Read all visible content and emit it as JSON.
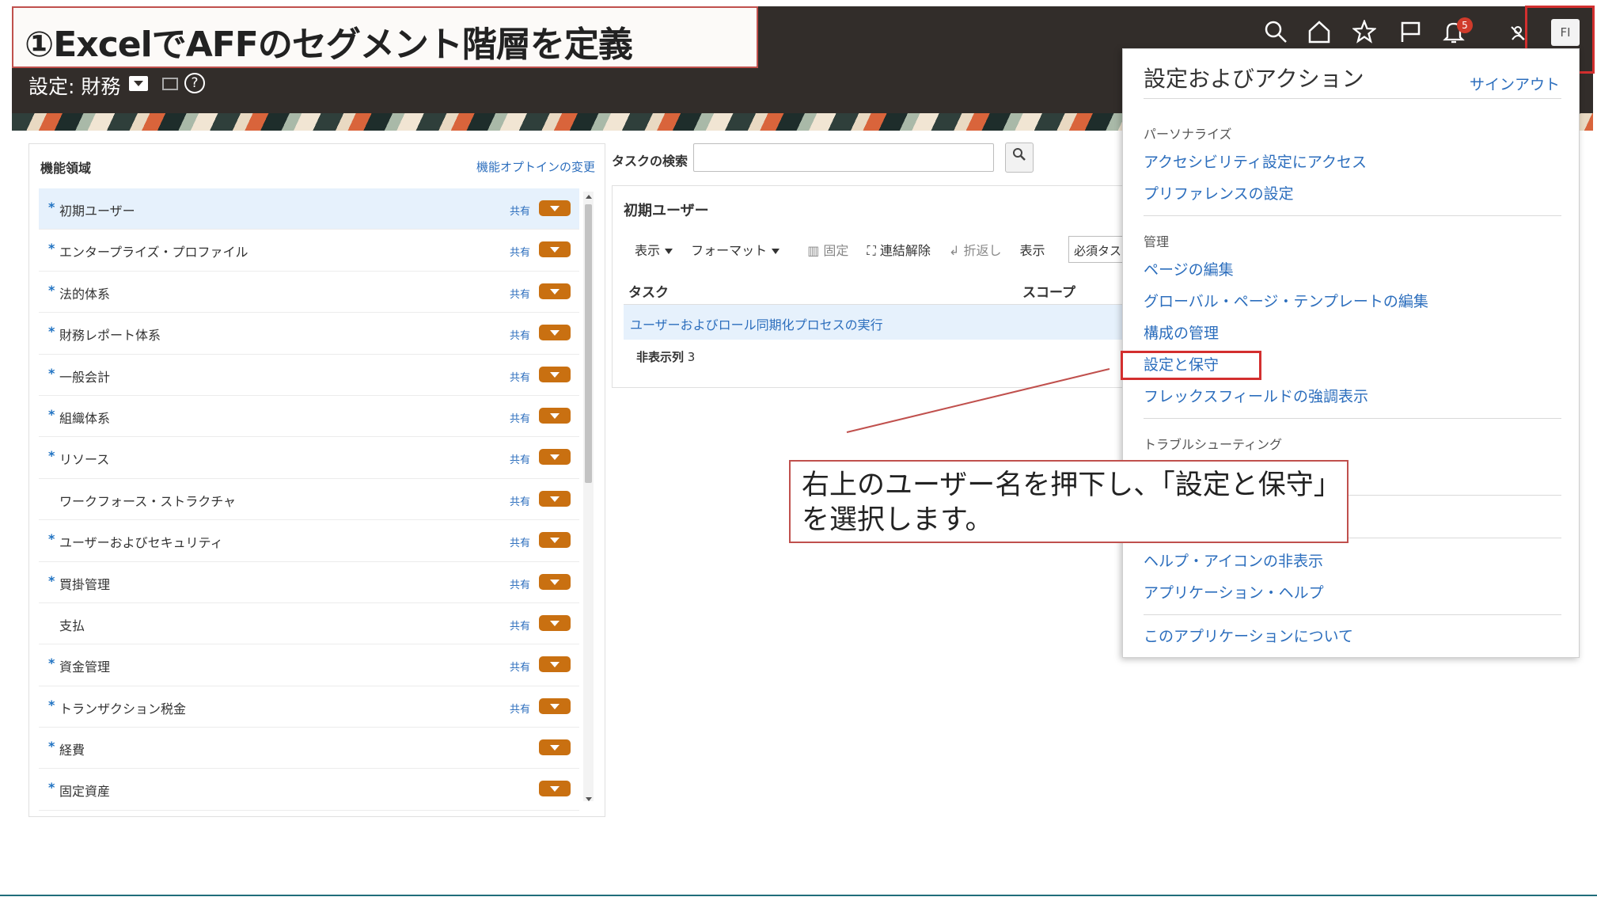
{
  "slide": {
    "title": "①ExcelでAFFのセグメント階層を定義"
  },
  "header": {
    "setup_label": "設定: 財務",
    "notification_count": "5",
    "user_initials": "FI"
  },
  "left_panel": {
    "title": "機能領域",
    "change_link": "機能オプトインの変更",
    "items": [
      {
        "star": "*",
        "name": "初期ユーザー",
        "shared": "共有"
      },
      {
        "star": "*",
        "name": "エンタープライズ・プロファイル",
        "shared": "共有"
      },
      {
        "star": "*",
        "name": "法的体系",
        "shared": "共有"
      },
      {
        "star": "*",
        "name": "財務レポート体系",
        "shared": "共有"
      },
      {
        "star": "*",
        "name": "一般会計",
        "shared": "共有"
      },
      {
        "star": "*",
        "name": "組織体系",
        "shared": "共有"
      },
      {
        "star": "*",
        "name": "リソース",
        "shared": "共有"
      },
      {
        "star": "",
        "name": "ワークフォース・ストラクチャ",
        "shared": "共有"
      },
      {
        "star": "*",
        "name": "ユーザーおよびセキュリティ",
        "shared": "共有"
      },
      {
        "star": "*",
        "name": "買掛管理",
        "shared": "共有"
      },
      {
        "star": "",
        "name": "支払",
        "shared": "共有"
      },
      {
        "star": "*",
        "name": "資金管理",
        "shared": "共有"
      },
      {
        "star": "*",
        "name": "トランザクション税金",
        "shared": "共有"
      },
      {
        "star": "*",
        "name": "経費",
        "shared": ""
      },
      {
        "star": "*",
        "name": "固定資産",
        "shared": ""
      }
    ]
  },
  "task_search": {
    "label": "タスクの検索",
    "value": ""
  },
  "task_panel": {
    "title": "初期ユーザー",
    "toolbar": {
      "view": "表示",
      "format": "フォーマット",
      "freeze": "固定",
      "detach": "連結解除",
      "wrap": "折返し",
      "show": "表示",
      "show_select": "必須タスク"
    },
    "columns": [
      "タスク",
      "スコープ"
    ],
    "rows": [
      {
        "task": "ユーザーおよびロール同期化プロセスの実行"
      }
    ],
    "hidden_label": "非表示列",
    "hidden_count": "3"
  },
  "dropdown": {
    "title": "設定およびアクション",
    "signout": "サインアウト",
    "sections": [
      {
        "label": "パーソナライズ",
        "items": [
          "アクセシビリティ設定にアクセス",
          "プリファレンスの設定"
        ]
      },
      {
        "label": "管理",
        "items": [
          "ページの編集",
          "グローバル・ページ・テンプレートの編集",
          "構成の管理",
          "設定と保守",
          "フレックスフィールドの強調表示"
        ]
      },
      {
        "label": "トラブルシューティング",
        "items": []
      },
      {
        "label": "",
        "items": [
          "ヘルプ・アイコンの非表示",
          "アプリケーション・ヘルプ"
        ]
      },
      {
        "label": "",
        "items": [
          "このアプリケーションについて"
        ]
      }
    ]
  },
  "callout": {
    "text": "右上のユーザー名を押下し、「設定と保守」を選択します。"
  },
  "colors": {
    "header_bg": "#322d2a",
    "accent_orange": "#c97011",
    "link_blue": "#2c6ebd",
    "highlight_red": "#d32f2f",
    "selected_row": "#e6f1fc"
  }
}
